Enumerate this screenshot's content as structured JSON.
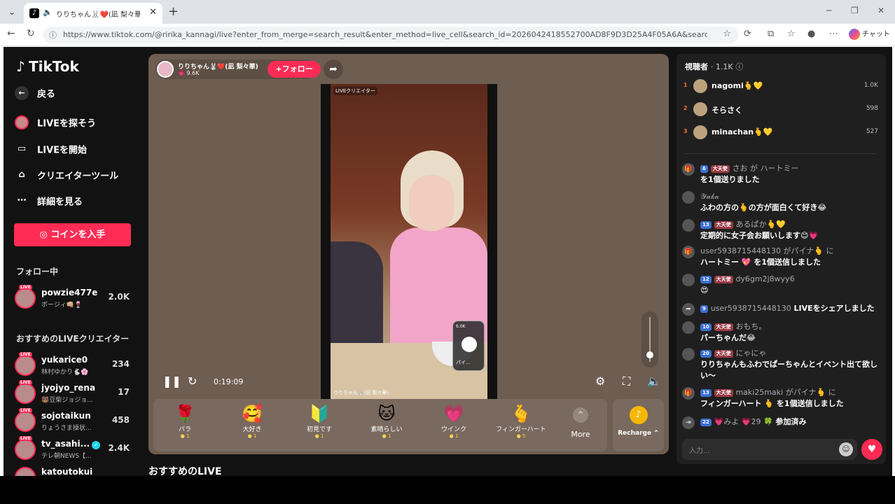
{
  "browser": {
    "tab_title": "りりちゃん🐰❤️(凪 梨々華) (@ri...",
    "url": "https://www.tiktok.com/@ririka_kannagi/live?enter_from_merge=search_result&enter_method=live_cell&search_id=2026042418552700AD8F9D3D25A4F05A6A&search_keyword=...",
    "copilot_label": "チャット"
  },
  "sidebar": {
    "logo": "TikTok",
    "back": "戻る",
    "items": [
      {
        "label": "LIVEを探そう"
      },
      {
        "label": "LIVEを開始"
      },
      {
        "label": "クリエイターツール"
      },
      {
        "label": "詳細を見る"
      }
    ],
    "coin_button": "コインを入手",
    "following_title": "フォロー中",
    "following": [
      {
        "name": "powzie477e",
        "sub": "ポージィ👊🏼🍷",
        "count": "2.0K"
      }
    ],
    "recommended_title": "おすすめのLIVEクリエイター",
    "recommended": [
      {
        "name": "yukarice0",
        "sub": "林村ゆかり🐇🌸",
        "count": "234"
      },
      {
        "name": "jyojyo_rena",
        "sub": "🐻豆柴ジョジョ...",
        "count": "17"
      },
      {
        "name": "sojotaikun",
        "sub": "りょうさま操状...",
        "count": "458"
      },
      {
        "name": "tv_asahi...",
        "sub": "テレ朝NEWS【...",
        "count": "2.4K"
      },
      {
        "name": "katoutokui",
        "sub": "",
        "count": ""
      }
    ]
  },
  "player": {
    "host_name": "りりちゃん🐰❤️(凪 梨々華)",
    "host_likes": "💗 9.6K",
    "follow_label": "+フォロー",
    "video_tag": "LIVEクリエイター",
    "video_bottom": "りりちゃん🐰(凪 梨々華)",
    "mini_count": "6.0K",
    "mini_name": "パイ...",
    "timer": "0:19:09",
    "gifts": [
      {
        "icon": "🌹",
        "name": "バラ",
        "price": "1"
      },
      {
        "icon": "🥰",
        "name": "大好き",
        "price": "1"
      },
      {
        "icon": "🔰",
        "name": "初見です",
        "price": "1"
      },
      {
        "icon": "🐱",
        "name": "素晴らしい",
        "price": "1"
      },
      {
        "icon": "💗",
        "name": "ウインク",
        "price": "1"
      },
      {
        "icon": "🫰",
        "name": "フィンガーハート",
        "price": "5"
      }
    ],
    "more_label": "More",
    "recharge_label": "Recharge ^",
    "recommended_live": "おすすめのLIVE"
  },
  "chat": {
    "viewers_label": "視聴者",
    "viewers_count": "· 1.1K",
    "ranking": [
      {
        "no": "1",
        "name": "nagomi🫰💛",
        "score": "1.0K"
      },
      {
        "no": "2",
        "name": "そらさく",
        "score": "598"
      },
      {
        "no": "3",
        "name": "minachan🫰💛",
        "score": "527"
      }
    ],
    "messages": [
      {
        "lv": "6",
        "badge": "大天使",
        "user": "さお が ハートミー",
        "text": "を1個送りました"
      },
      {
        "lv": "",
        "badge": "",
        "user": "𝒴𝓊𝓀𝒶",
        "text": "ふわの方の🫰の方が面白くて好き😂"
      },
      {
        "lv": "13",
        "badge": "大天使",
        "user": "あるぱか🫰💛",
        "text": "定期的に女子会お願いします😊💗"
      },
      {
        "lv": "",
        "badge": "",
        "user": "user5938715448130 がパイナ🫰 に",
        "text": "ハートミー 💖 を1個送信しました"
      },
      {
        "lv": "12",
        "badge": "大天使",
        "user": "dy6gm2j8wyy6",
        "text": "😍"
      },
      {
        "lv": "9",
        "badge": "",
        "user": "user5938715448130",
        "text": "LIVEをシェアしました"
      },
      {
        "lv": "10",
        "badge": "大天使",
        "user": "おもち。",
        "text": "パーちゃんだ😂"
      },
      {
        "lv": "20",
        "badge": "大天使",
        "user": "にゃにゃ",
        "text": "りりちゃんもふわでぱーちゃんとイベント出て欲しい〜"
      },
      {
        "lv": "13",
        "badge": "大天使",
        "user": "maki25maki がパイナ🫰 に",
        "text": "フィンガーハート 🫰 を1個送信しました"
      },
      {
        "lv": "22",
        "badge": "",
        "user": "💗みよ 💗29 🍀",
        "text": "参加済み"
      }
    ],
    "input_placeholder": "入力..."
  }
}
